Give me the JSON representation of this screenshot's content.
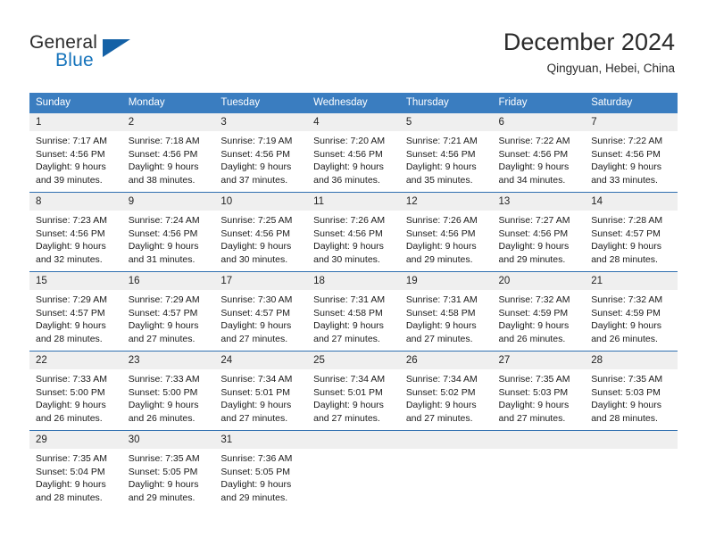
{
  "branding": {
    "logo_text_top": "General",
    "logo_text_bottom": "Blue",
    "logo_accent_color": "#1573bb"
  },
  "header": {
    "title": "December 2024",
    "subtitle": "Qingyuan, Hebei, China"
  },
  "theme": {
    "header_band_color": "#3a7dc0",
    "week_divider_color": "#2f6fb0",
    "daynum_band_color": "#efefef"
  },
  "weekday_headers": [
    "Sunday",
    "Monday",
    "Tuesday",
    "Wednesday",
    "Thursday",
    "Friday",
    "Saturday"
  ],
  "weeks": [
    {
      "days": [
        {
          "date": "1",
          "sunrise": "Sunrise: 7:17 AM",
          "sunset": "Sunset: 4:56 PM",
          "daylight_1": "Daylight: 9 hours",
          "daylight_2": "and 39 minutes."
        },
        {
          "date": "2",
          "sunrise": "Sunrise: 7:18 AM",
          "sunset": "Sunset: 4:56 PM",
          "daylight_1": "Daylight: 9 hours",
          "daylight_2": "and 38 minutes."
        },
        {
          "date": "3",
          "sunrise": "Sunrise: 7:19 AM",
          "sunset": "Sunset: 4:56 PM",
          "daylight_1": "Daylight: 9 hours",
          "daylight_2": "and 37 minutes."
        },
        {
          "date": "4",
          "sunrise": "Sunrise: 7:20 AM",
          "sunset": "Sunset: 4:56 PM",
          "daylight_1": "Daylight: 9 hours",
          "daylight_2": "and 36 minutes."
        },
        {
          "date": "5",
          "sunrise": "Sunrise: 7:21 AM",
          "sunset": "Sunset: 4:56 PM",
          "daylight_1": "Daylight: 9 hours",
          "daylight_2": "and 35 minutes."
        },
        {
          "date": "6",
          "sunrise": "Sunrise: 7:22 AM",
          "sunset": "Sunset: 4:56 PM",
          "daylight_1": "Daylight: 9 hours",
          "daylight_2": "and 34 minutes."
        },
        {
          "date": "7",
          "sunrise": "Sunrise: 7:22 AM",
          "sunset": "Sunset: 4:56 PM",
          "daylight_1": "Daylight: 9 hours",
          "daylight_2": "and 33 minutes."
        }
      ]
    },
    {
      "days": [
        {
          "date": "8",
          "sunrise": "Sunrise: 7:23 AM",
          "sunset": "Sunset: 4:56 PM",
          "daylight_1": "Daylight: 9 hours",
          "daylight_2": "and 32 minutes."
        },
        {
          "date": "9",
          "sunrise": "Sunrise: 7:24 AM",
          "sunset": "Sunset: 4:56 PM",
          "daylight_1": "Daylight: 9 hours",
          "daylight_2": "and 31 minutes."
        },
        {
          "date": "10",
          "sunrise": "Sunrise: 7:25 AM",
          "sunset": "Sunset: 4:56 PM",
          "daylight_1": "Daylight: 9 hours",
          "daylight_2": "and 30 minutes."
        },
        {
          "date": "11",
          "sunrise": "Sunrise: 7:26 AM",
          "sunset": "Sunset: 4:56 PM",
          "daylight_1": "Daylight: 9 hours",
          "daylight_2": "and 30 minutes."
        },
        {
          "date": "12",
          "sunrise": "Sunrise: 7:26 AM",
          "sunset": "Sunset: 4:56 PM",
          "daylight_1": "Daylight: 9 hours",
          "daylight_2": "and 29 minutes."
        },
        {
          "date": "13",
          "sunrise": "Sunrise: 7:27 AM",
          "sunset": "Sunset: 4:56 PM",
          "daylight_1": "Daylight: 9 hours",
          "daylight_2": "and 29 minutes."
        },
        {
          "date": "14",
          "sunrise": "Sunrise: 7:28 AM",
          "sunset": "Sunset: 4:57 PM",
          "daylight_1": "Daylight: 9 hours",
          "daylight_2": "and 28 minutes."
        }
      ]
    },
    {
      "days": [
        {
          "date": "15",
          "sunrise": "Sunrise: 7:29 AM",
          "sunset": "Sunset: 4:57 PM",
          "daylight_1": "Daylight: 9 hours",
          "daylight_2": "and 28 minutes."
        },
        {
          "date": "16",
          "sunrise": "Sunrise: 7:29 AM",
          "sunset": "Sunset: 4:57 PM",
          "daylight_1": "Daylight: 9 hours",
          "daylight_2": "and 27 minutes."
        },
        {
          "date": "17",
          "sunrise": "Sunrise: 7:30 AM",
          "sunset": "Sunset: 4:57 PM",
          "daylight_1": "Daylight: 9 hours",
          "daylight_2": "and 27 minutes."
        },
        {
          "date": "18",
          "sunrise": "Sunrise: 7:31 AM",
          "sunset": "Sunset: 4:58 PM",
          "daylight_1": "Daylight: 9 hours",
          "daylight_2": "and 27 minutes."
        },
        {
          "date": "19",
          "sunrise": "Sunrise: 7:31 AM",
          "sunset": "Sunset: 4:58 PM",
          "daylight_1": "Daylight: 9 hours",
          "daylight_2": "and 27 minutes."
        },
        {
          "date": "20",
          "sunrise": "Sunrise: 7:32 AM",
          "sunset": "Sunset: 4:59 PM",
          "daylight_1": "Daylight: 9 hours",
          "daylight_2": "and 26 minutes."
        },
        {
          "date": "21",
          "sunrise": "Sunrise: 7:32 AM",
          "sunset": "Sunset: 4:59 PM",
          "daylight_1": "Daylight: 9 hours",
          "daylight_2": "and 26 minutes."
        }
      ]
    },
    {
      "days": [
        {
          "date": "22",
          "sunrise": "Sunrise: 7:33 AM",
          "sunset": "Sunset: 5:00 PM",
          "daylight_1": "Daylight: 9 hours",
          "daylight_2": "and 26 minutes."
        },
        {
          "date": "23",
          "sunrise": "Sunrise: 7:33 AM",
          "sunset": "Sunset: 5:00 PM",
          "daylight_1": "Daylight: 9 hours",
          "daylight_2": "and 26 minutes."
        },
        {
          "date": "24",
          "sunrise": "Sunrise: 7:34 AM",
          "sunset": "Sunset: 5:01 PM",
          "daylight_1": "Daylight: 9 hours",
          "daylight_2": "and 27 minutes."
        },
        {
          "date": "25",
          "sunrise": "Sunrise: 7:34 AM",
          "sunset": "Sunset: 5:01 PM",
          "daylight_1": "Daylight: 9 hours",
          "daylight_2": "and 27 minutes."
        },
        {
          "date": "26",
          "sunrise": "Sunrise: 7:34 AM",
          "sunset": "Sunset: 5:02 PM",
          "daylight_1": "Daylight: 9 hours",
          "daylight_2": "and 27 minutes."
        },
        {
          "date": "27",
          "sunrise": "Sunrise: 7:35 AM",
          "sunset": "Sunset: 5:03 PM",
          "daylight_1": "Daylight: 9 hours",
          "daylight_2": "and 27 minutes."
        },
        {
          "date": "28",
          "sunrise": "Sunrise: 7:35 AM",
          "sunset": "Sunset: 5:03 PM",
          "daylight_1": "Daylight: 9 hours",
          "daylight_2": "and 28 minutes."
        }
      ]
    },
    {
      "days": [
        {
          "date": "29",
          "sunrise": "Sunrise: 7:35 AM",
          "sunset": "Sunset: 5:04 PM",
          "daylight_1": "Daylight: 9 hours",
          "daylight_2": "and 28 minutes."
        },
        {
          "date": "30",
          "sunrise": "Sunrise: 7:35 AM",
          "sunset": "Sunset: 5:05 PM",
          "daylight_1": "Daylight: 9 hours",
          "daylight_2": "and 29 minutes."
        },
        {
          "date": "31",
          "sunrise": "Sunrise: 7:36 AM",
          "sunset": "Sunset: 5:05 PM",
          "daylight_1": "Daylight: 9 hours",
          "daylight_2": "and 29 minutes."
        },
        {
          "date": "",
          "sunrise": "",
          "sunset": "",
          "daylight_1": "",
          "daylight_2": ""
        },
        {
          "date": "",
          "sunrise": "",
          "sunset": "",
          "daylight_1": "",
          "daylight_2": ""
        },
        {
          "date": "",
          "sunrise": "",
          "sunset": "",
          "daylight_1": "",
          "daylight_2": ""
        },
        {
          "date": "",
          "sunrise": "",
          "sunset": "",
          "daylight_1": "",
          "daylight_2": ""
        }
      ]
    }
  ]
}
